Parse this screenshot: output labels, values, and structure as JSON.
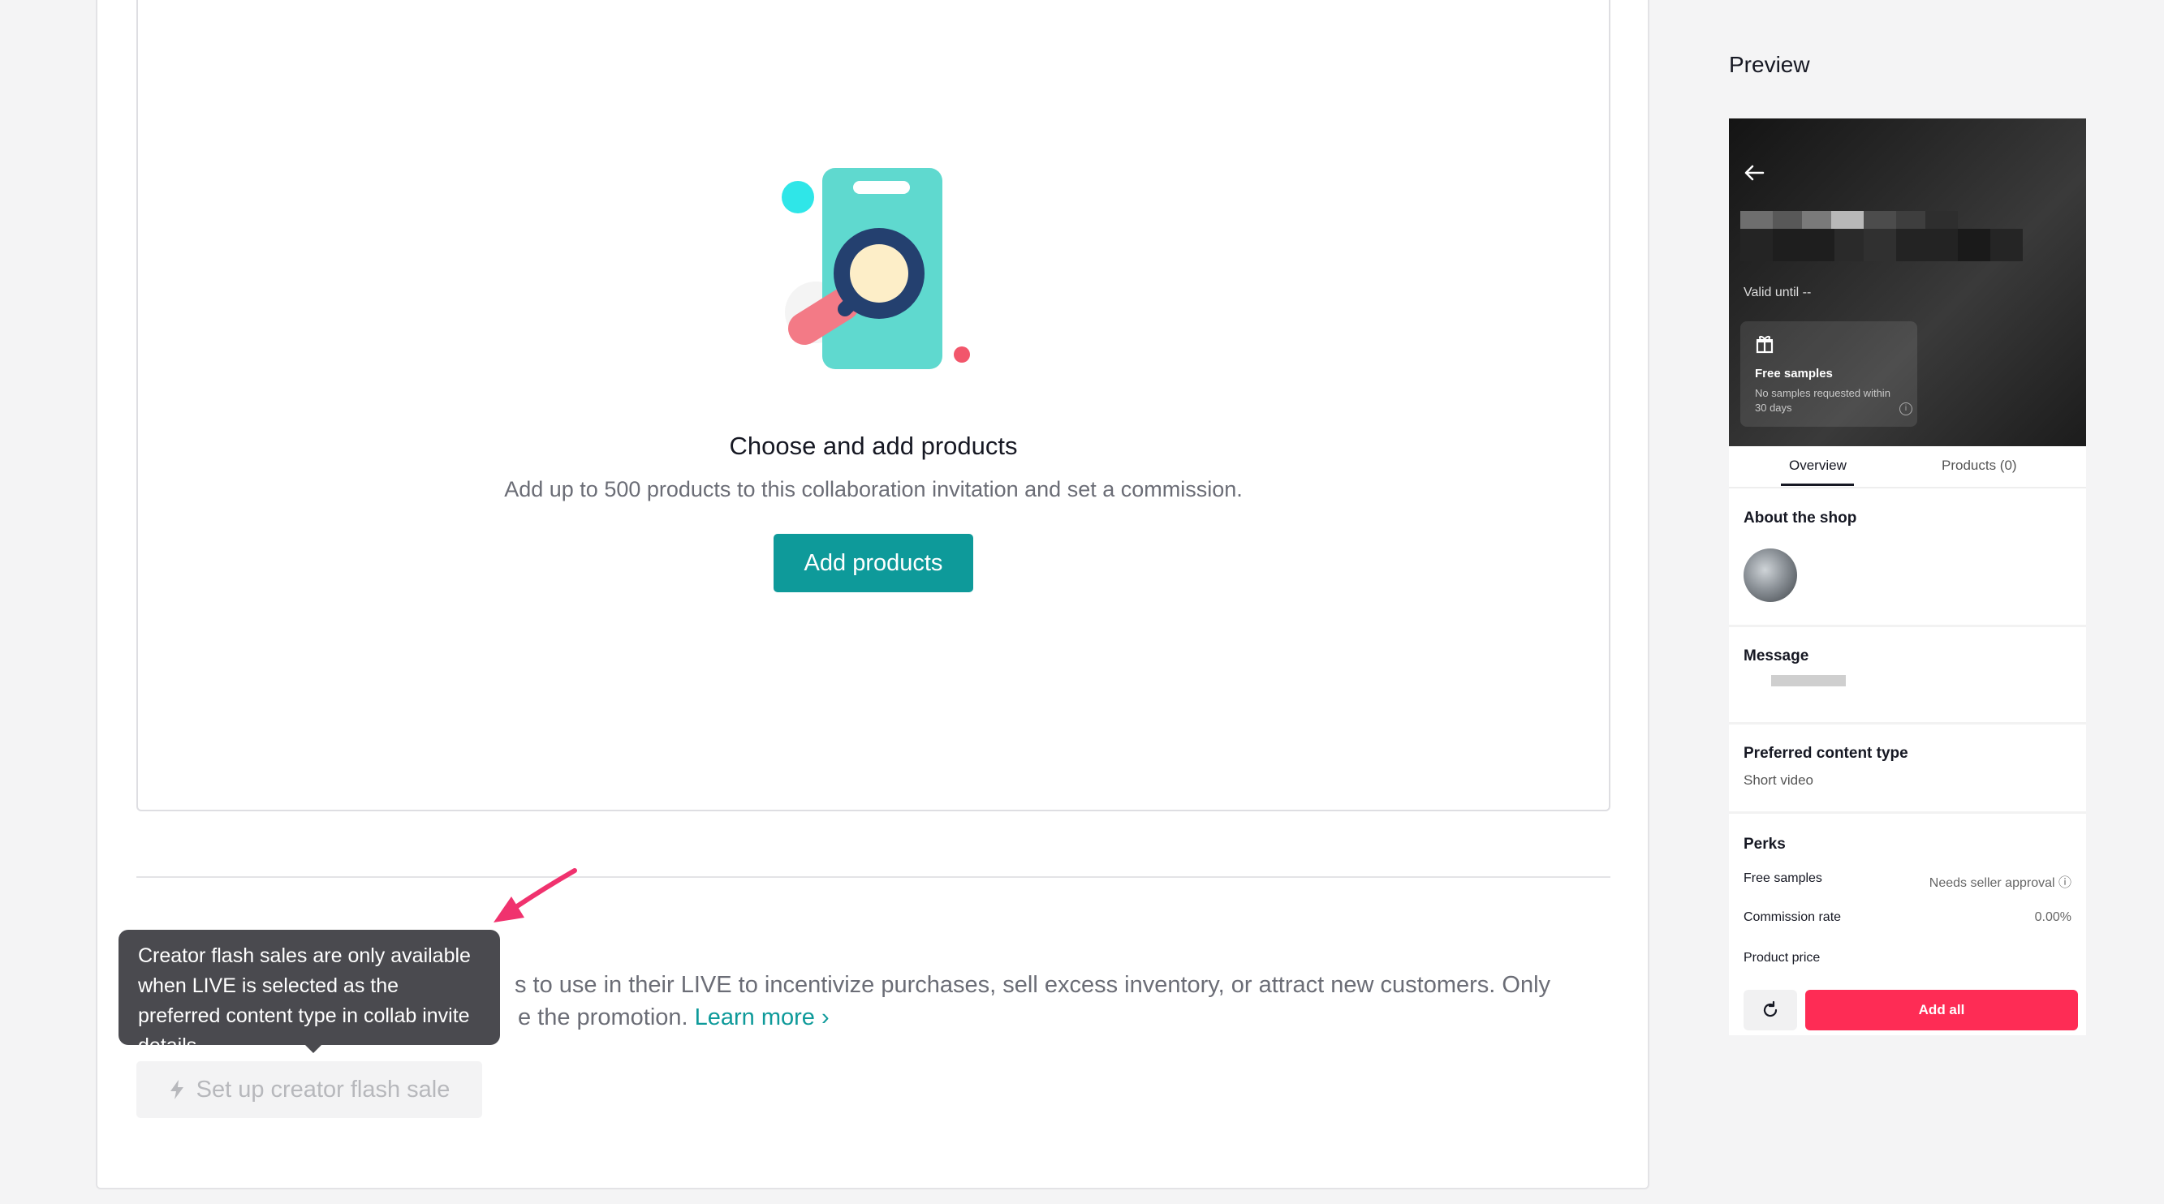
{
  "products": {
    "title": "Choose and add products",
    "description": "Add up to 500 products to this collaboration invitation and set a commission.",
    "add_button": "Add products"
  },
  "flash_sale": {
    "description_visible": "s to use in their LIVE to incentivize purchases, sell excess inventory, or attract new customers. Only",
    "description_line2": "e the promotion.",
    "learn_more": "Learn more",
    "button": "Set up creator flash sale",
    "tooltip": "Creator flash sales are only available when LIVE is selected as the preferred content type in collab invite details."
  },
  "preview": {
    "title": "Preview",
    "valid_until": "Valid until --",
    "perk_card": {
      "title": "Free samples",
      "subtitle": "No samples requested within 30 days"
    },
    "tabs": {
      "overview": "Overview",
      "products": "Products (0)"
    },
    "about_shop": "About the shop",
    "message": "Message",
    "preferred_content_type": {
      "label": "Preferred content type",
      "value": "Short video"
    },
    "perks": {
      "title": "Perks",
      "rows": [
        {
          "label": "Free samples",
          "value": "Needs seller approval ⓘ"
        },
        {
          "label": "Commission rate",
          "value": "0.00%"
        },
        {
          "label": "Product price",
          "value": ""
        }
      ]
    },
    "add_all": "Add all"
  },
  "colors": {
    "accent_teal": "#0e9a9a",
    "cta_red": "#fe2c55",
    "annotation_pink": "#f0326e"
  }
}
